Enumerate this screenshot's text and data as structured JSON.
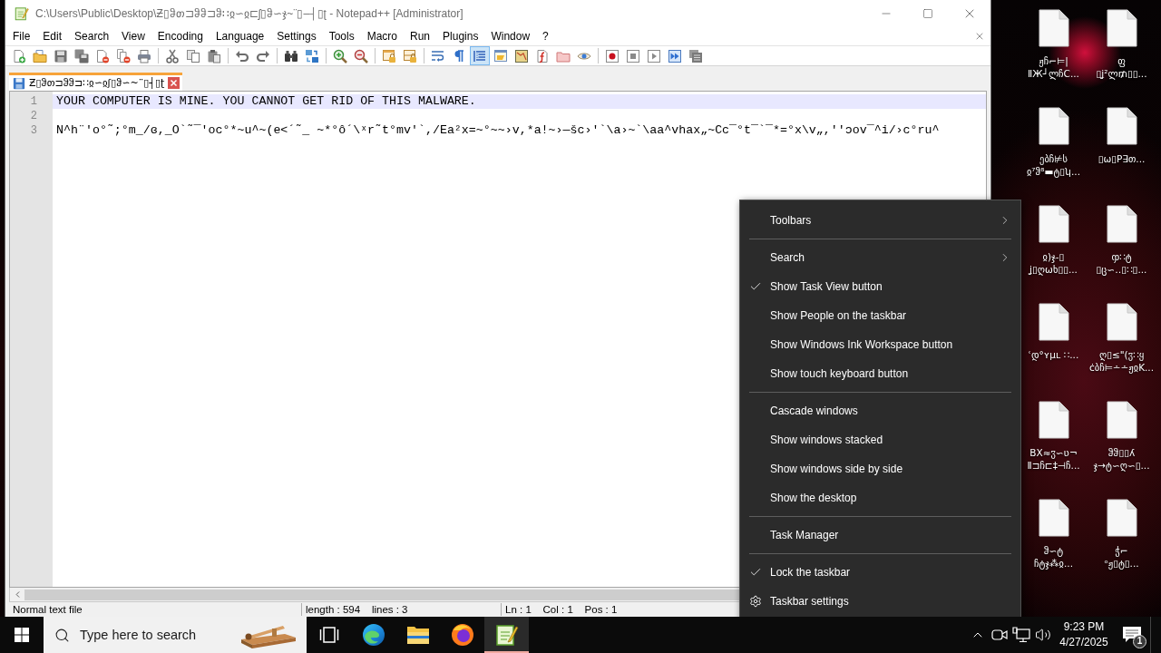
{
  "window": {
    "title": "C:\\Users\\Public\\Desktop\\Ƶ▯ჵთ⊐ჵჵ⊐ჵ∷ჲ∽ჲ⊏ʃ▯ჵ∽ჯ~¨▯‒┤▯ʈ - Notepad++ [Administrator]"
  },
  "menu": [
    "File",
    "Edit",
    "Search",
    "View",
    "Encoding",
    "Language",
    "Settings",
    "Tools",
    "Macro",
    "Run",
    "Plugins",
    "Window",
    "?"
  ],
  "toolbar": [
    {
      "kind": "new",
      "pressed": false
    },
    {
      "kind": "open",
      "pressed": false
    },
    {
      "kind": "save",
      "pressed": false
    },
    {
      "kind": "save-all",
      "pressed": false
    },
    {
      "kind": "close",
      "pressed": false
    },
    {
      "kind": "close-all",
      "pressed": false
    },
    {
      "kind": "print",
      "pressed": false
    },
    {
      "kind": "separator"
    },
    {
      "kind": "cut",
      "pressed": false
    },
    {
      "kind": "copy",
      "pressed": false
    },
    {
      "kind": "paste",
      "pressed": false
    },
    {
      "kind": "separator"
    },
    {
      "kind": "undo",
      "pressed": false
    },
    {
      "kind": "redo",
      "pressed": false
    },
    {
      "kind": "separator"
    },
    {
      "kind": "find",
      "pressed": false
    },
    {
      "kind": "replace",
      "pressed": false
    },
    {
      "kind": "separator"
    },
    {
      "kind": "zoom-in",
      "pressed": false
    },
    {
      "kind": "zoom-out",
      "pressed": false
    },
    {
      "kind": "separator"
    },
    {
      "kind": "sync-v",
      "pressed": false
    },
    {
      "kind": "sync-h",
      "pressed": false
    },
    {
      "kind": "separator"
    },
    {
      "kind": "wrap",
      "pressed": false
    },
    {
      "kind": "all-chars",
      "pressed": false
    },
    {
      "kind": "indent-guide",
      "pressed": true
    },
    {
      "kind": "udl",
      "pressed": false
    },
    {
      "kind": "doc-map",
      "pressed": false
    },
    {
      "kind": "function-list",
      "pressed": false
    },
    {
      "kind": "folder-workspace",
      "pressed": false
    },
    {
      "kind": "monitor",
      "pressed": false
    },
    {
      "kind": "separator"
    },
    {
      "kind": "record",
      "pressed": false
    },
    {
      "kind": "stop",
      "pressed": false
    },
    {
      "kind": "play",
      "pressed": false
    },
    {
      "kind": "run-multiple",
      "pressed": false
    },
    {
      "kind": "save-macro",
      "pressed": false
    }
  ],
  "tabs": [
    {
      "label": "Ƶ▯ჵთ⊐ჵჵ⊐∷ჲ∽ჲʃ▯ჵ∽~¨▯┤▯ʈ",
      "selected": true
    }
  ],
  "editor": {
    "lines": [
      {
        "number": "1",
        "text": "YOUR COMPUTER IS MINE. YOU CANNOT GET RID OF THIS MALWARE.",
        "current": true
      },
      {
        "number": "2",
        "current": false
      },
      {
        "number": "3",
        "text": "N^h¨'o°˜;°m_/ɞ,_O`˜¯'oc°*~u^~(e<´˜_ ~*°ô´\\ˣr˜t°mv'`,/Ea²x=~°~~›v,*a!~›—šc›'`\\a›~`\\aa^vhax„~Cc¯°t¯`¯*=°x\\v„,''ɔov¯^i/›c°ru^",
        "current": false
      }
    ]
  },
  "status_bar": [
    "Normal text file",
    "length : 594    lines : 3",
    "Ln : 1    Col : 1    Pos : 1"
  ],
  "desktop_icons": [
    {
      "label_lines": [
        "ჟჩ⌐⊨|",
        "ⅡЖ┘ლჩC..."
      ]
    },
    {
      "label_lines": [
        "ფ",
        "▯ʝ²ლ₥▯▯..."
      ]
    },
    {
      "label_lines": [
        "ებჩ⊭ს",
        "ჲ⁷ჵ⁸▬ტ▯ʮ..."
      ]
    },
    {
      "label_lines": [
        "▯ω▯P∃თ..."
      ]
    },
    {
      "label_lines": [
        "ჲ)ჯ‐▯",
        "ʝ▯ღωხ▯▯..."
      ]
    },
    {
      "label_lines": [
        "ჶ∷ტ",
        "▯ც∽‥▯∷▯..."
      ]
    },
    {
      "label_lines": [
        "ʿდ°ʏµʟ ∷..."
      ]
    },
    {
      "label_lines": [
        "ღ▯≤\"(ჳ∷ყ",
        "ċბჩ⊨∸∸ჟჲK..."
      ]
    },
    {
      "label_lines": [
        "ВX≈ჳ∽ʋ¬",
        "Ⅱ⊐ჩ⊏‡⊣ჩ..."
      ]
    },
    {
      "label_lines": [
        "ჵჵ▯▯ʎ",
        "ჯ→ტ∽ღ∽▯..."
      ]
    },
    {
      "label_lines": [
        "ჵ∽ტ",
        "ჩტჯ⁂ჲ..."
      ]
    },
    {
      "label_lines": [
        "ჭ⌐",
        "ᵒჟ▯ტ▯..."
      ]
    }
  ],
  "context_menu": {
    "items": [
      {
        "kind": "submenu",
        "label": "Toolbars"
      },
      {
        "kind": "separator"
      },
      {
        "kind": "submenu",
        "label": "Search"
      },
      {
        "kind": "toggle",
        "label": "Show Task View button",
        "checked": true
      },
      {
        "kind": "toggle",
        "label": "Show People on the taskbar",
        "checked": false
      },
      {
        "kind": "toggle",
        "label": "Show Windows Ink Workspace button",
        "checked": false
      },
      {
        "kind": "toggle",
        "label": "Show touch keyboard button",
        "checked": false
      },
      {
        "kind": "separator"
      },
      {
        "kind": "command",
        "label": "Cascade windows"
      },
      {
        "kind": "command",
        "label": "Show windows stacked"
      },
      {
        "kind": "command",
        "label": "Show windows side by side"
      },
      {
        "kind": "command",
        "label": "Show the desktop"
      },
      {
        "kind": "separator"
      },
      {
        "kind": "command",
        "label": "Task Manager"
      },
      {
        "kind": "separator"
      },
      {
        "kind": "toggle",
        "label": "Lock the taskbar",
        "checked": true
      },
      {
        "kind": "settings",
        "label": "Taskbar settings"
      }
    ]
  },
  "taskbar": {
    "search": {
      "placeholder": "Type here to search"
    },
    "apps": [
      {
        "kind": "task-view",
        "active": false
      },
      {
        "kind": "edge",
        "active": false
      },
      {
        "kind": "explorer",
        "active": false
      },
      {
        "kind": "firefox",
        "active": false
      },
      {
        "kind": "notepad",
        "active": true
      }
    ],
    "clock": {
      "time": "9:23 PM",
      "date": "4/27/2025"
    },
    "notifications": {
      "count": "1"
    }
  }
}
